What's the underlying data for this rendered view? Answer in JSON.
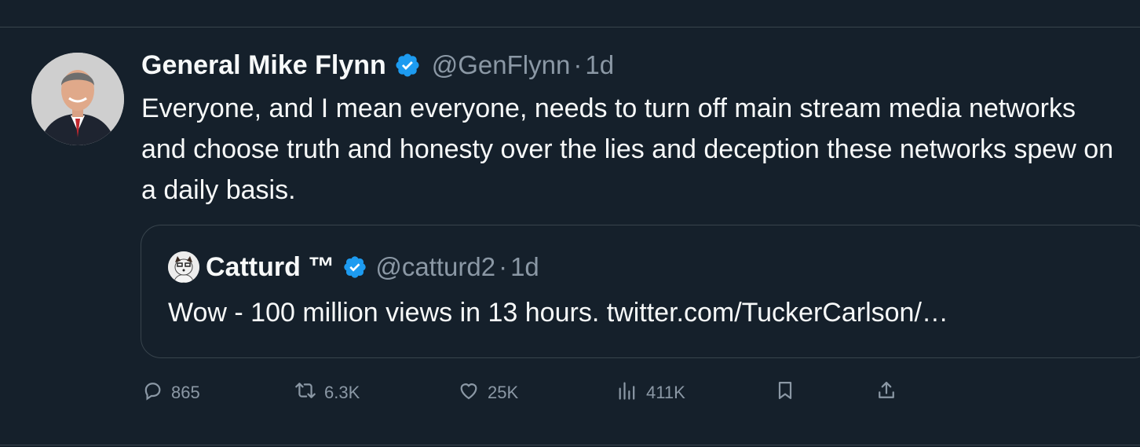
{
  "tweet": {
    "author_name": "General Mike Flynn",
    "author_handle": "@GenFlynn",
    "separator": "·",
    "time": "1d",
    "text": "Everyone, and I mean everyone, needs to turn off main stream media networks and choose truth and honesty over the lies and deception these networks spew on a daily basis."
  },
  "quote": {
    "author_name": "Catturd ™",
    "author_handle": "@catturd2",
    "separator": "·",
    "time": "1d",
    "text": "Wow - 100 million views in 13 hours. twitter.com/TuckerCarlson/…"
  },
  "actions": {
    "replies": "865",
    "retweets": "6.3K",
    "likes": "25K",
    "views": "411K"
  },
  "colors": {
    "background": "#15202b",
    "text": "#f7f9f9",
    "muted": "#8b98a5",
    "border": "#38444d",
    "verified": "#1d9bf0"
  }
}
